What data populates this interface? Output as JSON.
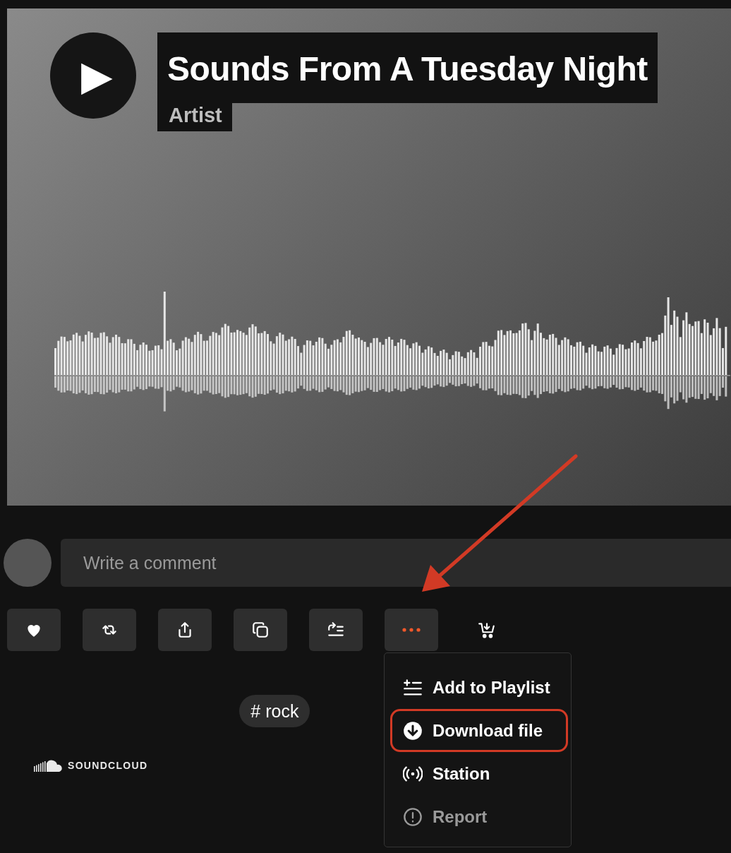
{
  "track": {
    "play_label": "▶",
    "title": "Sounds From A Tuesday Night",
    "artist": "Artist"
  },
  "comment": {
    "placeholder": "Write a comment"
  },
  "actions": [
    {
      "kind": "like",
      "open": false
    },
    {
      "kind": "repost",
      "open": false
    },
    {
      "kind": "share",
      "open": false
    },
    {
      "kind": "copy",
      "open": false
    },
    {
      "kind": "queue",
      "open": false
    },
    {
      "kind": "more",
      "open": true
    },
    {
      "kind": "buy",
      "open": false
    }
  ],
  "menu": [
    {
      "kind": "playlist",
      "label": "Add to Playlist",
      "disabled": false,
      "highlighted": false
    },
    {
      "kind": "download",
      "label": "Download file",
      "disabled": false,
      "highlighted": true
    },
    {
      "kind": "station",
      "label": "Station",
      "disabled": false,
      "highlighted": false
    },
    {
      "kind": "report",
      "label": "Report",
      "disabled": true,
      "highlighted": false
    }
  ],
  "tag": "# rock",
  "logo": "SOUNDCLOUD"
}
